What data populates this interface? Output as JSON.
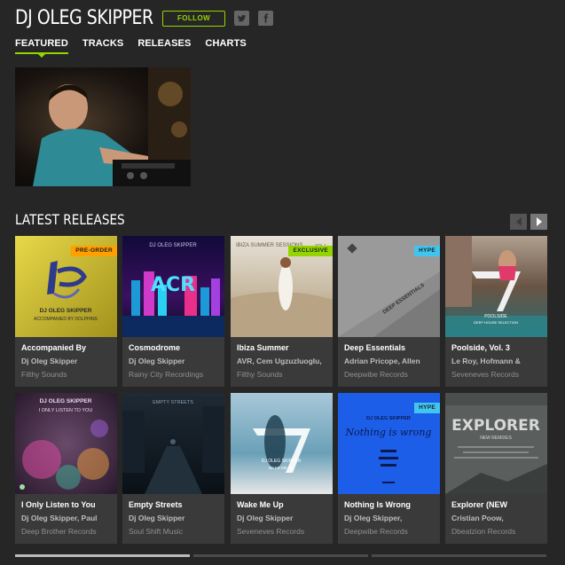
{
  "artist": {
    "name": "DJ OLEG SKIPPER"
  },
  "follow_label": "FOLLOW",
  "social": {
    "twitter_icon": "twitter-icon",
    "facebook_icon": "facebook-icon"
  },
  "nav": [
    "FEATURED",
    "TRACKS",
    "RELEASES",
    "CHARTS"
  ],
  "active_nav": "FEATURED",
  "section_title": "LATEST RELEASES",
  "colors": {
    "accent": "#94d500",
    "preorder": "#ff9f00",
    "exclusive": "#94d500",
    "hype": "#3fc5f0"
  },
  "releases": [
    {
      "title": "Accompanied By",
      "artists": "Dj Oleg Skipper",
      "label": "Filthy Sounds",
      "tag": "PRE-ORDER",
      "tag_color": "#ff9f00",
      "art": {
        "text": "DJ OLEG SKIPPER",
        "subtext": "ACCOMPANIED BY DOLPHINS"
      }
    },
    {
      "title": "Cosmodrome",
      "artists": "Dj Oleg Skipper",
      "label": "Rainy City Recordings",
      "tag": "",
      "tag_color": "",
      "art": {
        "text": "DJ OLEG SKIPPER",
        "subtext": ""
      }
    },
    {
      "title": "Ibiza Summer",
      "artists": "AVR, Cem Ugzuzluoglu,",
      "label": "Filthy Sounds",
      "tag": "EXCLUSIVE",
      "tag_color": "#94d500",
      "art": {
        "text": "IBIZA SUMMER SESSIONS",
        "subtext": "VOL.1"
      }
    },
    {
      "title": "Deep Essentials",
      "artists": "Adrian Pricope, Allen",
      "label": "Deepwibe Records",
      "tag": "HYPE",
      "tag_color": "#3fc5f0",
      "art": {
        "text": "DEEP ESSENTIALS",
        "subtext": ""
      }
    },
    {
      "title": "Poolside, Vol. 3",
      "artists": "Le Roy, Hofmann &",
      "label": "Seveneves Records",
      "tag": "",
      "tag_color": "",
      "art": {
        "text": "POOLSIDE",
        "subtext": "DEEP HOUSE SELECTION"
      }
    },
    {
      "title": "I Only Listen to You",
      "artists": "Dj Oleg Skipper, Paul",
      "label": "Deep Brother Records",
      "tag": "",
      "tag_color": "",
      "art": {
        "text": "DJ OLEG SKIPPER",
        "subtext": "I ONLY LISTEN TO YOU"
      }
    },
    {
      "title": "Empty Streets",
      "artists": "Dj Oleg Skipper",
      "label": "Soul Shift Music",
      "tag": "",
      "tag_color": "",
      "art": {
        "text": "EMPTY STREETS",
        "subtext": ""
      }
    },
    {
      "title": "Wake Me Up",
      "artists": "Dj Oleg Skipper",
      "label": "Seveneves Records",
      "tag": "",
      "tag_color": "",
      "art": {
        "text": "DJ OLEG SKIPPER",
        "subtext": "WAKE ME UP"
      }
    },
    {
      "title": "Nothing Is Wrong",
      "artists": "Dj Oleg Skipper,",
      "label": "Deepwibe Records",
      "tag": "HYPE",
      "tag_color": "#3fc5f0",
      "art": {
        "text": "DJ OLEG SKIPPER",
        "subtext": "Nothing is wrong"
      }
    },
    {
      "title": "Explorer (NEW",
      "artists": "Cristian Poow,",
      "label": "Dbeatzion Records",
      "tag": "",
      "tag_color": "",
      "art": {
        "text": "EXPLORER",
        "subtext": "NEW REMIXES"
      }
    }
  ],
  "pager": {
    "pages": 3,
    "current": 1
  }
}
